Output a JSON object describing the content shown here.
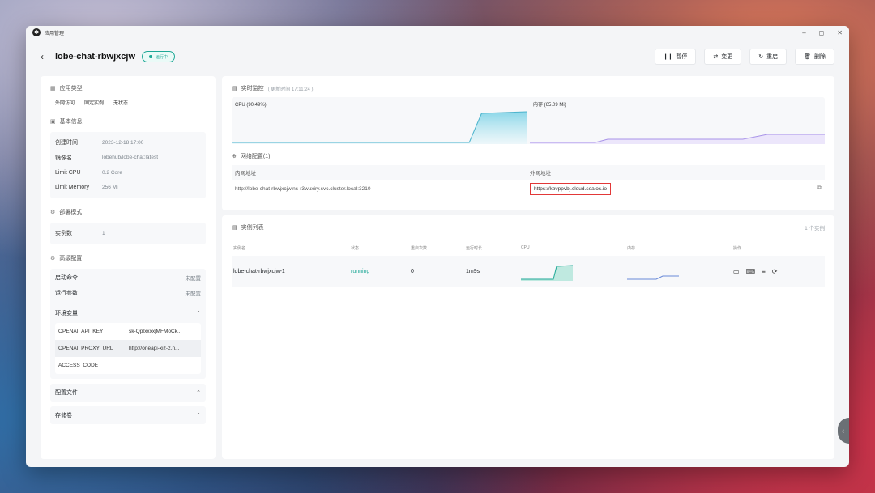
{
  "window": {
    "title": "应用管理",
    "logo": "sealos-logo"
  },
  "header": {
    "back_icon": "‹",
    "app_name": "lobe-chat-rbwjxcjw",
    "status": "运行中",
    "buttons": [
      {
        "icon": "pause-icon",
        "label": "暂停"
      },
      {
        "icon": "swap-icon",
        "label": "变更"
      },
      {
        "icon": "restart-icon",
        "label": "重启"
      },
      {
        "icon": "trash-icon",
        "label": "删除"
      }
    ]
  },
  "left": {
    "app_type_title": "应用类型",
    "app_type_tags": [
      "外网访问",
      "固定实例",
      "无状态"
    ],
    "basic_title": "基本信息",
    "basic": [
      {
        "k": "创建时间",
        "v": "2023-12-18 17:00"
      },
      {
        "k": "镜像名",
        "v": "lobehub/lobe-chat:latest"
      },
      {
        "k": "Limit CPU",
        "v": "0.2 Core"
      },
      {
        "k": "Limit Memory",
        "v": "256 Mi"
      }
    ],
    "deploy_title": "部署模式",
    "deploy": {
      "k": "实例数",
      "v": "1"
    },
    "advanced_title": "高级配置",
    "start_cmd": {
      "k": "启动命令",
      "v": "未配置"
    },
    "run_args": {
      "k": "运行参数",
      "v": "未配置"
    },
    "env_title": "环境变量",
    "env": [
      {
        "k": "OPENAI_API_KEY",
        "v": "sk-QpIxxxxjMFMoCk..."
      },
      {
        "k": "OPENAI_PROXY_URL",
        "v": "http://oneapi-xiz-2.n..."
      },
      {
        "k": "ACCESS_CODE",
        "v": ""
      }
    ],
    "config_file_title": "配置文件",
    "storage_title": "存储卷"
  },
  "monitor": {
    "title": "实时监控",
    "updated": "( 更新时间 17:11:24 )",
    "cpu_label": "CPU (90.49%)",
    "mem_label": "内存 (65.09 Mi)"
  },
  "network": {
    "title": "网络配置(1)",
    "internal_header": "内网地址",
    "external_header": "外网地址",
    "internal": "http://lobe-chat-rbwjxcjw.ns-r3wuxiry.svc.cluster.local:3210",
    "external": "https://kbvppvbj.cloud.sealos.io"
  },
  "instances": {
    "title": "实例列表",
    "count": "1 个实例",
    "headers": [
      "实例名",
      "状态",
      "重启次数",
      "运行时长",
      "CPU",
      "内存",
      "操作"
    ],
    "rows": [
      {
        "name": "lobe-chat-rbwjxcjw-1",
        "status": "running",
        "restarts": "0",
        "uptime": "1m9s"
      }
    ]
  },
  "colors": {
    "accent": "#1ea896",
    "highlight": "#e23838"
  }
}
